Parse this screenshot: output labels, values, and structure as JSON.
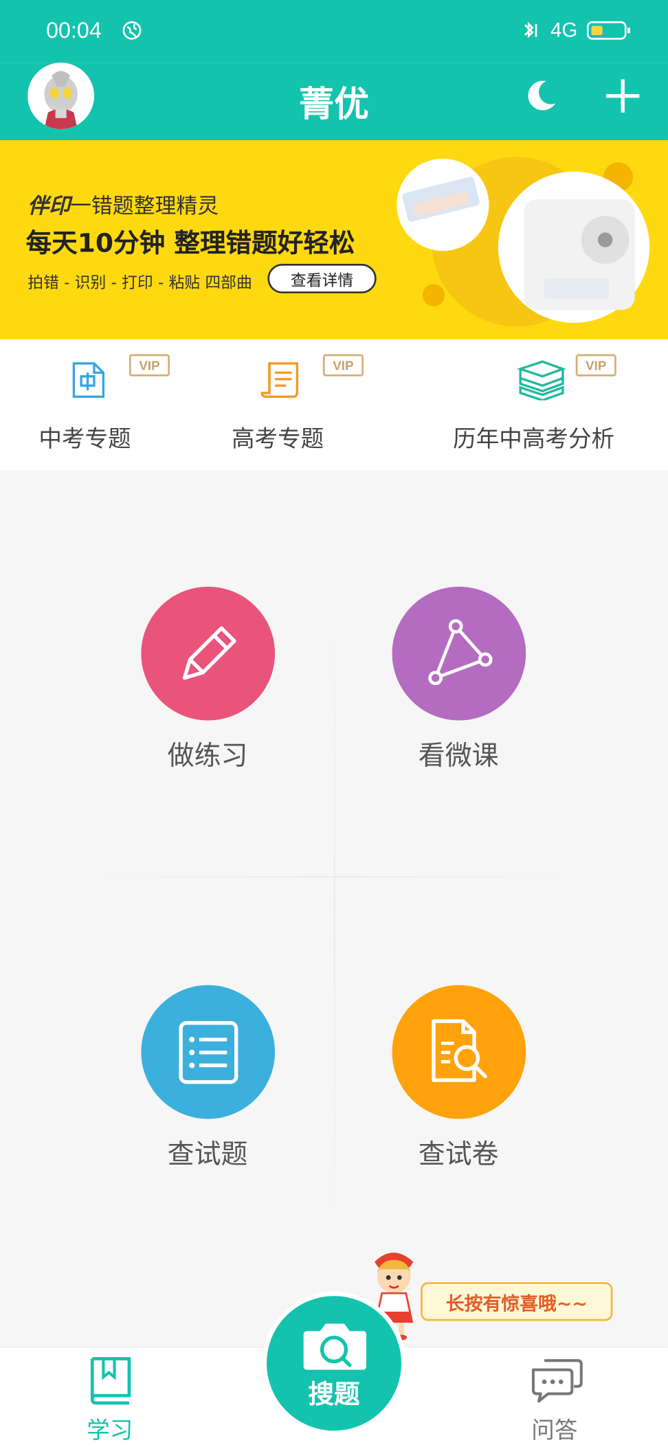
{
  "status": {
    "time": "00:04",
    "network": "4G"
  },
  "header": {
    "title": "菁优"
  },
  "banner": {
    "brand_name": "伴印",
    "brand_subtitle": "一错题整理精灵",
    "headline": "每天10分钟  整理错题好轻松",
    "steps": "拍错 - 识别 - 打印 - 粘贴 四部曲",
    "button_label": "查看详情"
  },
  "quick": {
    "badge": "VIP",
    "items": [
      {
        "label": "中考专题",
        "icon": "doc-zhong-icon"
      },
      {
        "label": "高考专题",
        "icon": "scroll-icon"
      },
      {
        "label": "历年中高考分析",
        "icon": "books-icon"
      }
    ]
  },
  "grid": [
    {
      "label": "做练习",
      "color": "#e9547b",
      "icon": "pencil-icon"
    },
    {
      "label": "看微课",
      "color": "#b46cc0",
      "icon": "triangle-icon"
    },
    {
      "label": "查试题",
      "color": "#3cb0dc",
      "icon": "list-icon"
    },
    {
      "label": "查试卷",
      "color": "#ffa20c",
      "icon": "doc-search-icon"
    }
  ],
  "tooltip": "长按有惊喜哦~~",
  "tabs": {
    "study": "学习",
    "search": "搜题",
    "qa": "问答"
  },
  "colors": {
    "primary": "#13c3ae",
    "banner": "#ffd90f"
  }
}
